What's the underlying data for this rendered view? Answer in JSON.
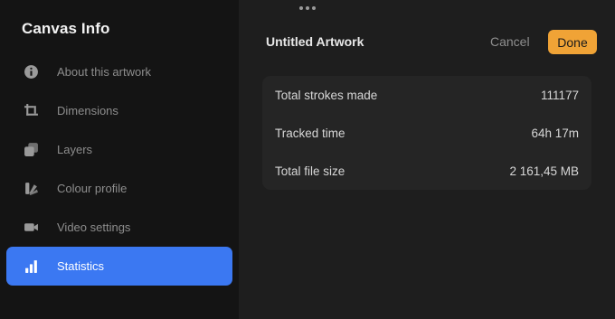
{
  "sidebar": {
    "title": "Canvas Info",
    "items": [
      {
        "label": "About this artwork",
        "icon": "info-icon",
        "active": false
      },
      {
        "label": "Dimensions",
        "icon": "crop-icon",
        "active": false
      },
      {
        "label": "Layers",
        "icon": "layers-icon",
        "active": false
      },
      {
        "label": "Colour profile",
        "icon": "colour-profile-icon",
        "active": false
      },
      {
        "label": "Video settings",
        "icon": "video-icon",
        "active": false
      },
      {
        "label": "Statistics",
        "icon": "statistics-icon",
        "active": true
      }
    ]
  },
  "header": {
    "title": "Untitled Artwork",
    "cancel_label": "Cancel",
    "done_label": "Done"
  },
  "statistics": [
    {
      "label": "Total strokes made",
      "value": "111177"
    },
    {
      "label": "Tracked time",
      "value": "64h 17m"
    },
    {
      "label": "Total file size",
      "value": "2 161,45 MB"
    }
  ],
  "colors": {
    "accent": "#3b78f2",
    "done": "#f0a336",
    "sidebar_bg": "#141414",
    "main_bg": "#1e1e1e"
  }
}
